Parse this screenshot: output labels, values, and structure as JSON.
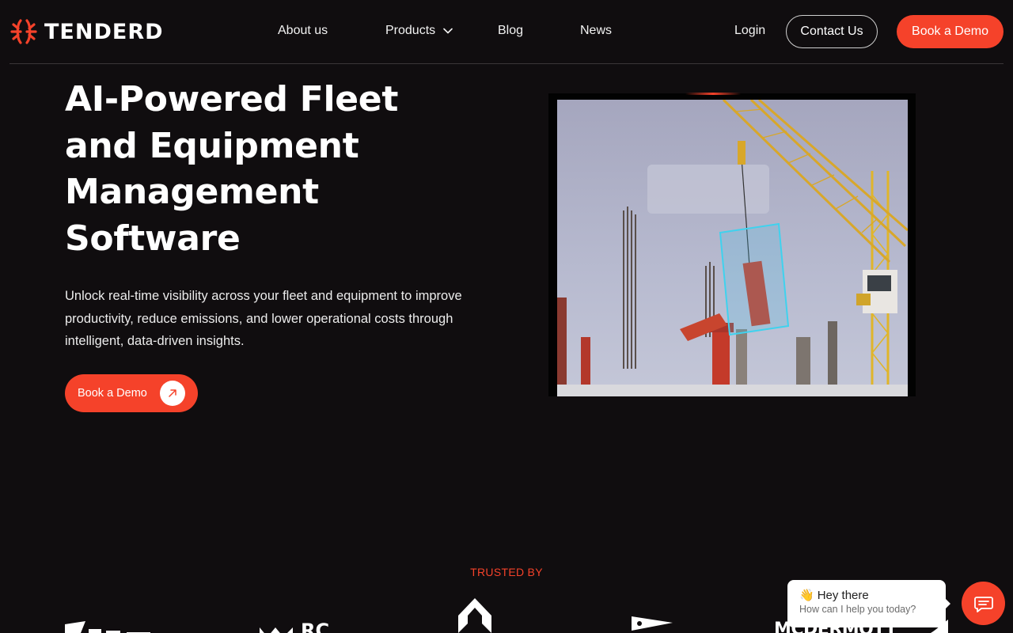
{
  "brand": {
    "name": "TENDERD",
    "accent_color": "#f5422a",
    "logo_icon": "tenderd-mark-icon"
  },
  "nav": {
    "items": [
      {
        "label": "About us"
      },
      {
        "label": "Products",
        "has_dropdown": true,
        "icon": "chevron-down-icon"
      },
      {
        "label": "Blog"
      },
      {
        "label": "News"
      }
    ],
    "login": "Login",
    "contact": "Contact Us",
    "demo": "Book a Demo"
  },
  "hero": {
    "title": "AI-Powered Fleet and Equipment Management Software",
    "subtitle": "Unlock real-time visibility across your fleet and equipment to improve productivity, reduce emissions, and lower operational costs through intelligent, data-driven insights.",
    "cta": "Book a Demo",
    "cta_icon": "arrow-up-right-icon",
    "media": "construction-crane-video"
  },
  "trusted": {
    "label": "TRUSTED BY",
    "partners": [
      {
        "name": "partner-logo-1"
      },
      {
        "name": "partner-logo-2",
        "text": "RC"
      },
      {
        "name": "partner-logo-3"
      },
      {
        "name": "partner-logo-4"
      },
      {
        "name": "partner-logo-5",
        "text": "MCDERMOTT"
      },
      {
        "name": "partner-logo-6"
      }
    ]
  },
  "chat": {
    "greeting": "Hey there",
    "emoji": "👋",
    "prompt": "How can I help you today?",
    "launcher_icon": "chat-icon"
  }
}
